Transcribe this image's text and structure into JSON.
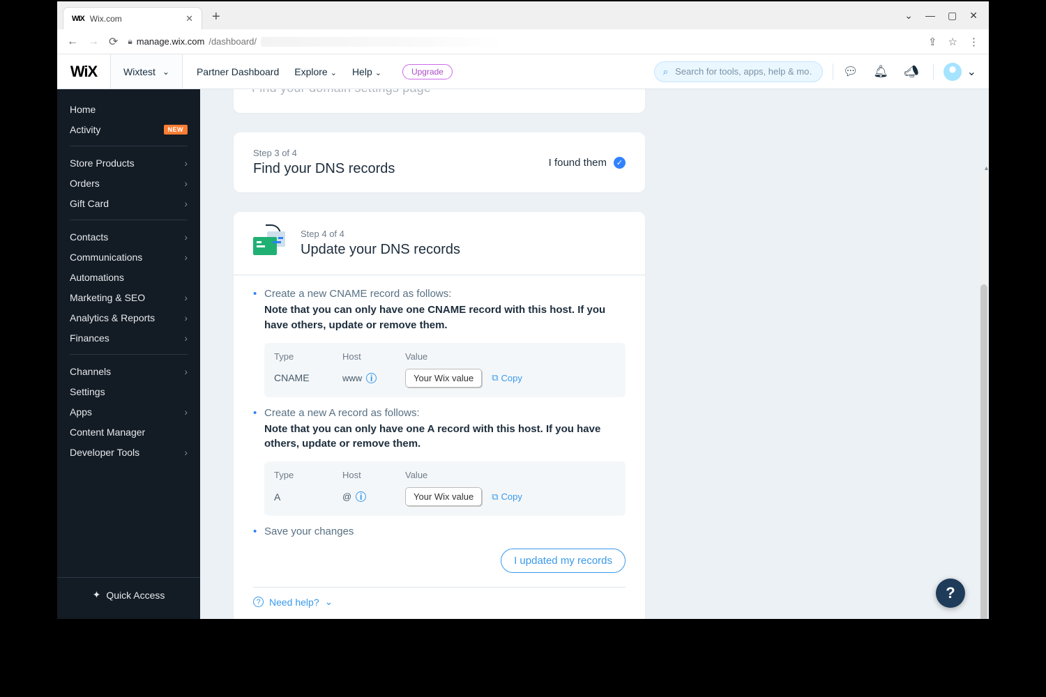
{
  "browser": {
    "tab_title": "Wix.com",
    "url_host": "manage.wix.com",
    "url_path": "/dashboard/"
  },
  "topbar": {
    "site_label": "Wixtest",
    "nav": {
      "partner": "Partner Dashboard",
      "explore": "Explore",
      "help": "Help"
    },
    "upgrade": "Upgrade",
    "search_placeholder": "Search for tools, apps, help & mo…"
  },
  "sidebar": {
    "home": "Home",
    "activity": "Activity",
    "new_badge": "NEW",
    "items1": [
      "Store Products",
      "Orders",
      "Gift Card"
    ],
    "items2": [
      "Contacts",
      "Communications",
      "Automations",
      "Marketing & SEO",
      "Analytics & Reports",
      "Finances"
    ],
    "items3": [
      "Channels",
      "Settings",
      "Apps",
      "Content Manager",
      "Developer Tools"
    ],
    "quick_access": "Quick Access"
  },
  "cards": {
    "prev_title_peek": "Find your domain settings page",
    "step3": {
      "step": "Step 3 of 4",
      "title": "Find your DNS records",
      "found": "I found them"
    },
    "step4": {
      "step": "Step 4 of 4",
      "title": "Update your DNS records",
      "cname_intro": "Create a new CNAME record as follows:",
      "cname_note": "Note that you can only have one CNAME record with this host. If you have others, update or remove them.",
      "a_intro": "Create a new A record as follows:",
      "a_note": "Note that you can only have one A record with this host. If you have others, update or remove them.",
      "save_line": "Save your changes",
      "cta": "I updated my records",
      "cols": {
        "type": "Type",
        "host": "Host",
        "value": "Value"
      },
      "cname_row": {
        "type": "CNAME",
        "host": "www",
        "value": "Your Wix value"
      },
      "a_row": {
        "type": "A",
        "host": "@",
        "value": "Your Wix value"
      },
      "copy": "Copy"
    },
    "need_help": "Need help?"
  }
}
